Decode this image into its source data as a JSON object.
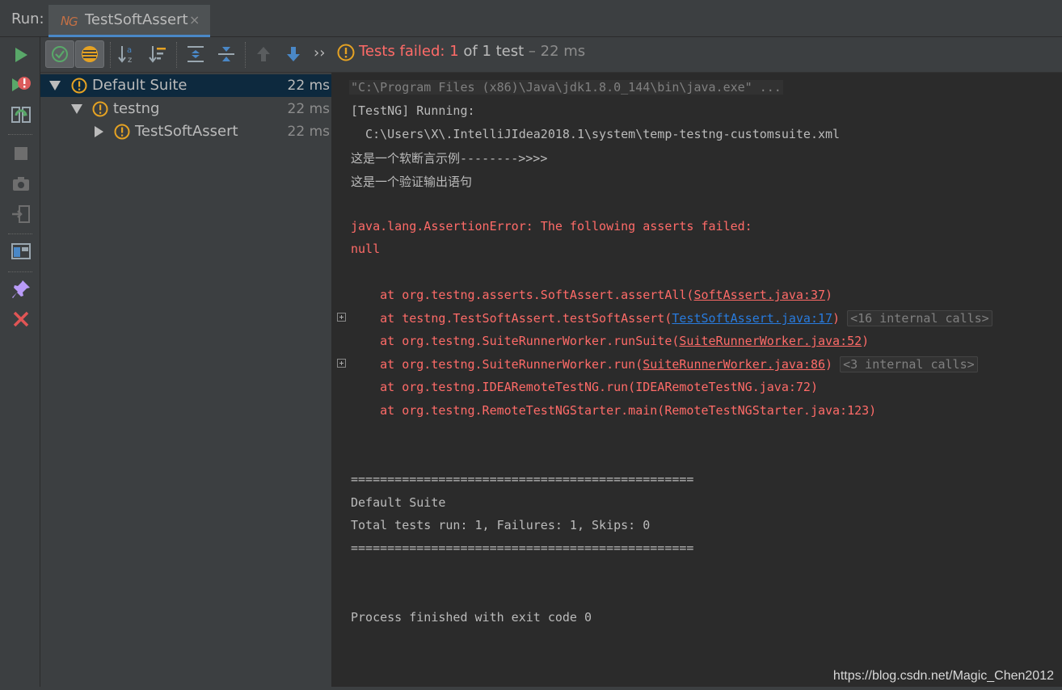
{
  "topbar": {
    "run_label": "Run:",
    "tab_title": "TestSoftAssert",
    "tab_icon": "testng-icon",
    "close_glyph": "×"
  },
  "left_toolbar": {
    "items": [
      "rerun-icon",
      "rerun-failed-icon",
      "toggle-auto-test-icon",
      "stop-icon",
      "screenshot-icon",
      "export-icon",
      "layout-icon",
      "pin-icon",
      "close-icon"
    ]
  },
  "toolbar": {
    "buttons": [
      "show-passed-icon",
      "show-ignored-icon",
      "sort-alpha-icon",
      "sort-duration-icon",
      "expand-all-icon",
      "collapse-all-icon",
      "prev-failed-icon",
      "next-failed-icon",
      "more-chevron-icon"
    ],
    "more_glyph": "››",
    "status_prefix": "Tests failed: 1",
    "status_of": " of 1 test",
    "status_duration": " – 22 ms"
  },
  "tree": {
    "nodes": [
      {
        "label": "Default Suite",
        "duration": "22 ms",
        "level": 0,
        "expanded": true,
        "selected": true
      },
      {
        "label": "testng",
        "duration": "22 ms",
        "level": 1,
        "expanded": true,
        "selected": false
      },
      {
        "label": "TestSoftAssert",
        "duration": "22 ms",
        "level": 2,
        "expanded": false,
        "selected": false
      }
    ]
  },
  "console": {
    "cmd": "\"C:\\Program Files (x86)\\Java\\jdk1.8.0_144\\bin\\java.exe\" ...",
    "running": "[TestNG] Running:",
    "suite_path": "  C:\\Users\\X\\.IntelliJIdea2018.1\\system\\temp-testng-customsuite.xml",
    "out1": "这是一个软断言示例-------->>>>",
    "out2": "这是一个验证输出语句",
    "error_header": "java.lang.AssertionError: The following asserts failed:",
    "error_null": "null",
    "stack": [
      {
        "prefix": "    at org.testng.asserts.SoftAssert.assertAll(",
        "link": "SoftAssert.java:37",
        "suffix": ")",
        "link_style": "err",
        "internal": ""
      },
      {
        "prefix": "    at testng.TestSoftAssert.testSoftAssert(",
        "link": "TestSoftAssert.java:17",
        "suffix": ")",
        "link_style": "blue",
        "internal": "<16 internal calls>"
      },
      {
        "prefix": "    at org.testng.SuiteRunnerWorker.runSuite(",
        "link": "SuiteRunnerWorker.java:52",
        "suffix": ")",
        "link_style": "err",
        "internal": ""
      },
      {
        "prefix": "    at org.testng.SuiteRunnerWorker.run(",
        "link": "SuiteRunnerWorker.java:86",
        "suffix": ")",
        "link_style": "err",
        "internal": "<3 internal calls>"
      },
      {
        "prefix": "    at org.testng.IDEARemoteTestNG.run(IDEARemoteTestNG.java:72)",
        "link": "",
        "suffix": "",
        "link_style": "none",
        "internal": ""
      },
      {
        "prefix": "    at org.testng.RemoteTestNGStarter.main(RemoteTestNGStarter.java:123)",
        "link": "",
        "suffix": "",
        "link_style": "none",
        "internal": ""
      }
    ],
    "divider1": "===============================================",
    "summary_suite": "Default Suite",
    "summary_totals": "Total tests run: 1, Failures: 1, Skips: 0",
    "divider2": "===============================================",
    "exit": "Process finished with exit code 0"
  },
  "watermark": "https://blog.csdn.net/Magic_Chen2012",
  "colors": {
    "failed": "#ff6b68",
    "link": "#287bde",
    "selection": "#0d293e",
    "warning": "#e5a223",
    "pass": "#59a869"
  }
}
